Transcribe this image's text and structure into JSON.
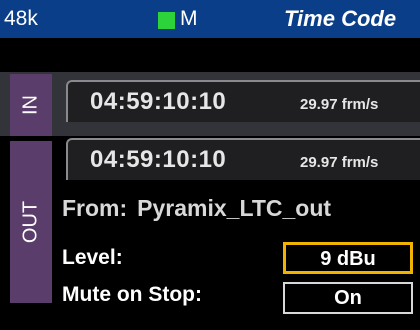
{
  "header": {
    "sample_rate": "48k",
    "mode_label": "M",
    "status_color": "#2cd33a",
    "title": "Time Code"
  },
  "in_section": {
    "tab_label": "IN",
    "timecode": "04:59:10:10",
    "frame_rate": "29.97 frm/s"
  },
  "out_section": {
    "tab_label": "OUT",
    "timecode": "04:59:10:10",
    "frame_rate": "29.97 frm/s",
    "from_label": "From:",
    "from_source": "Pyramix_LTC_out",
    "level_label": "Level:",
    "level_value": "9 dBu",
    "mute_label": "Mute on Stop:",
    "mute_value": "On"
  },
  "colors": {
    "header_bg": "#0b3e88",
    "tab_bg": "#5b3d6b",
    "focus_border": "#f0b400"
  }
}
